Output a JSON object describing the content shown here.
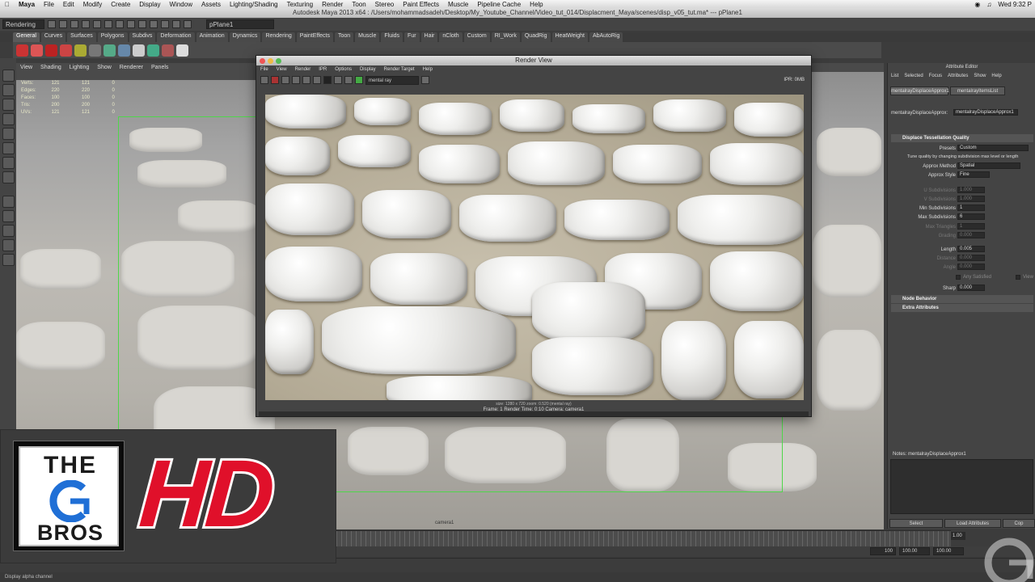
{
  "mac_menubar": {
    "app": "Maya",
    "items": [
      "File",
      "Edit",
      "Modify",
      "Create",
      "Display",
      "Window",
      "Assets",
      "Lighting/Shading",
      "Texturing",
      "Render",
      "Toon",
      "Stereo",
      "Paint Effects",
      "Muscle",
      "Pipeline Cache",
      "Help"
    ],
    "clock": "Wed 9:32 P"
  },
  "window_title": "Autodesk Maya 2013 x64 : /Users/mohammadsadeh/Desktop/My_Youtube_Channel/Video_tut_014/Displacment_Maya/scenes/disp_v05_tut.ma* --- pPlane1",
  "status_line": {
    "menu_set": "Rendering",
    "object_field": "pPlane1"
  },
  "shelf_tabs": [
    "General",
    "Curves",
    "Surfaces",
    "Polygons",
    "Subdivs",
    "Deformation",
    "Animation",
    "Dynamics",
    "Rendering",
    "PaintEffects",
    "Toon",
    "Muscle",
    "Fluids",
    "Fur",
    "Hair",
    "nCloth",
    "Custom",
    "RI_Work",
    "QuadRig",
    "HeatWeight",
    "AbAutoRig"
  ],
  "viewport": {
    "menu": [
      "View",
      "Shading",
      "Lighting",
      "Show",
      "Renderer",
      "Panels"
    ],
    "hud": [
      {
        "label": "Verts:",
        "a": "121",
        "b": "121",
        "c": "0"
      },
      {
        "label": "Edges:",
        "a": "220",
        "b": "220",
        "c": "0"
      },
      {
        "label": "Faces:",
        "a": "100",
        "b": "100",
        "c": "0"
      },
      {
        "label": "Tris:",
        "a": "200",
        "b": "200",
        "c": "0"
      },
      {
        "label": "UVs:",
        "a": "121",
        "b": "121",
        "c": "0"
      }
    ],
    "camera_label": "camera1"
  },
  "render_view": {
    "title": "Render View",
    "menu": [
      "File",
      "View",
      "Render",
      "IPR",
      "Options",
      "Display",
      "Render Target",
      "Help"
    ],
    "renderer": "mental ray",
    "ipr_label": "IPR: 0MB",
    "status_top": "size: 1280 x 720  zoom: 0.520       (mental ray)",
    "status_bottom": "Frame: 1        Render Time: 0:10        Camera: camera1"
  },
  "attribute_editor": {
    "title": "Attribute Editor",
    "menu": [
      "List",
      "Selected",
      "Focus",
      "Attributes",
      "Show",
      "Help"
    ],
    "tabs": [
      "mentalrayDisplaceApprox1",
      "mentalrayItemsList"
    ],
    "node_label": "mentalrayDisplaceApprox:",
    "node_value": "mentalrayDisplaceApprox1",
    "section_quality": "Displace Tessellation Quality",
    "presets_label": "Presets",
    "presets_value": "Custom",
    "tune_text": "Tune quality by changing subdivision max level or length",
    "approx_method_label": "Approx Method",
    "approx_method_value": "Spatial",
    "approx_style_label": "Approx Style",
    "approx_style_value": "Fine",
    "u_sub_label": "U Subdivisions",
    "u_sub_value": "1.000",
    "v_sub_label": "V Subdivisions",
    "v_sub_value": "1.000",
    "min_sub_label": "Min Subdivisions",
    "min_sub_value": "1",
    "max_sub_label": "Max Subdivisions",
    "max_sub_value": "6",
    "max_tri_label": "Max Triangles",
    "max_tri_value": "1",
    "grading_label": "Grading",
    "grading_value": "0.000",
    "length_label": "Length",
    "length_value": "0.005",
    "distance_label": "Distance",
    "distance_value": "0.000",
    "angle_label": "Angle",
    "angle_value": "0.000",
    "any_satisfied": "Any Satisfied",
    "view_dependent": "View",
    "sharp_label": "Sharp",
    "sharp_value": "0.000",
    "section_node": "Node Behavior",
    "section_extra": "Extra Attributes",
    "notes": "Notes:  mentalrayDisplaceApprox1",
    "btn_select": "Select",
    "btn_load": "Load Attributes",
    "btn_copy": "Cop"
  },
  "range": {
    "current": "1.00",
    "start": "100",
    "end1": "100.00",
    "end2": "100.00"
  },
  "help_line": "Display alpha channel",
  "logo": {
    "the": "THE",
    "cg": "CG",
    "bros": "BROS",
    "hd": "HD"
  },
  "colors": {
    "hd_red": "#e0102a",
    "selection_green": "#4fd64a",
    "maya_bg": "#444444"
  }
}
